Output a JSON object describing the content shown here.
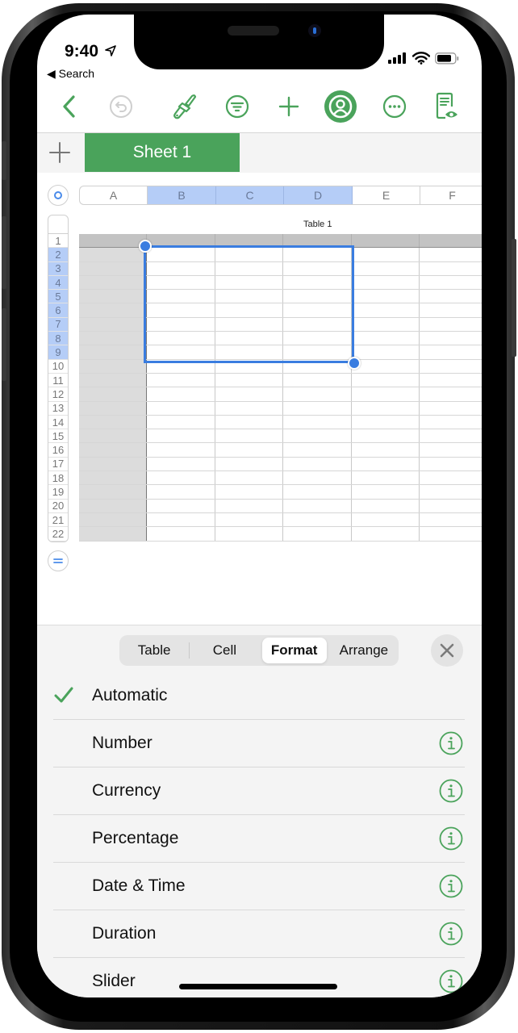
{
  "status_bar": {
    "time": "9:40",
    "back_app": "◀ Search"
  },
  "toolbar": {
    "icons": [
      "back-chevron",
      "undo",
      "paintbrush",
      "filter",
      "add",
      "collaborate",
      "more",
      "reader-view"
    ]
  },
  "sheets": {
    "add_label": "+",
    "tabs": [
      {
        "label": "Sheet 1",
        "active": true
      }
    ]
  },
  "spreadsheet": {
    "columns": [
      "A",
      "B",
      "C",
      "D",
      "E",
      "F"
    ],
    "selected_columns": [
      "B",
      "C",
      "D"
    ],
    "rows": [
      "1",
      "2",
      "3",
      "4",
      "5",
      "6",
      "7",
      "8",
      "9",
      "10",
      "11",
      "12",
      "13",
      "14",
      "15",
      "16",
      "17",
      "18",
      "19",
      "20",
      "21",
      "22"
    ],
    "selected_rows": [
      "2",
      "3",
      "4",
      "5",
      "6",
      "7",
      "8",
      "9"
    ],
    "table_title": "Table 1",
    "selection_range": "B2:D9"
  },
  "format_panel": {
    "tabs": [
      {
        "label": "Table",
        "active": false
      },
      {
        "label": "Cell",
        "active": false
      },
      {
        "label": "Format",
        "active": true
      },
      {
        "label": "Arrange",
        "active": false
      }
    ],
    "close_label": "✕",
    "options": [
      {
        "label": "Automatic",
        "checked": true,
        "info": false
      },
      {
        "label": "Number",
        "checked": false,
        "info": true
      },
      {
        "label": "Currency",
        "checked": false,
        "info": true
      },
      {
        "label": "Percentage",
        "checked": false,
        "info": true
      },
      {
        "label": "Date & Time",
        "checked": false,
        "info": true
      },
      {
        "label": "Duration",
        "checked": false,
        "info": true
      },
      {
        "label": "Slider",
        "checked": false,
        "info": true
      }
    ]
  },
  "colors": {
    "accent": "#4aa35b",
    "selection": "#3a7de0",
    "header_selected": "#b5cdf7"
  }
}
